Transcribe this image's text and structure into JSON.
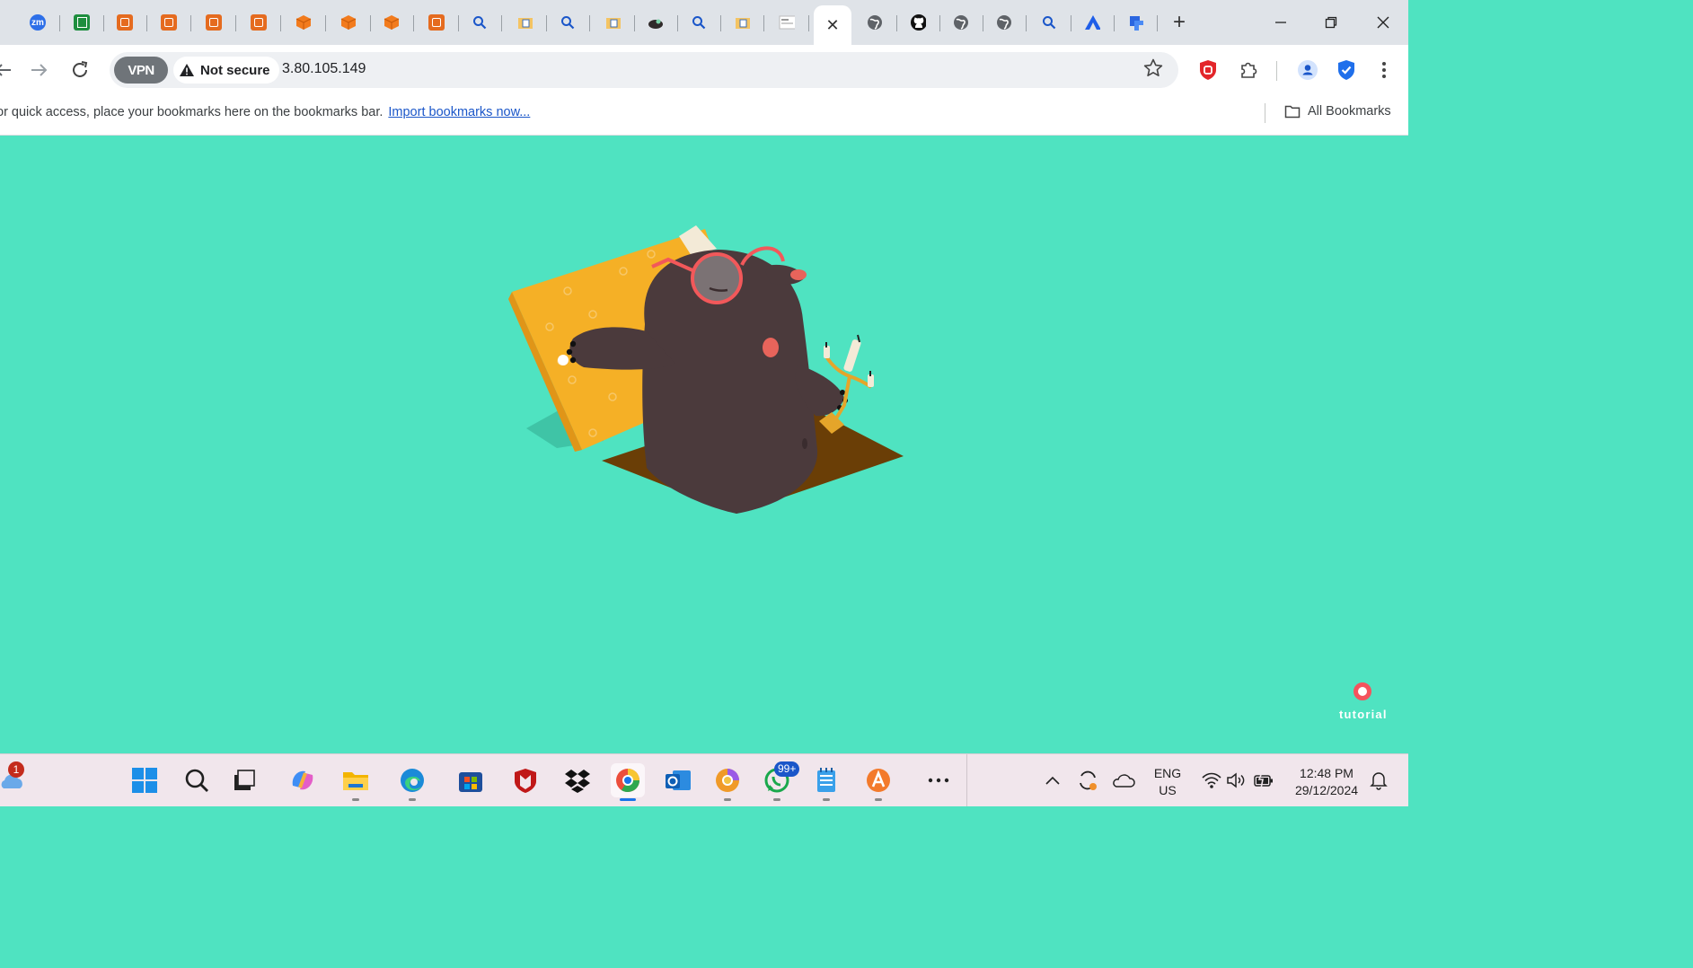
{
  "browser": {
    "tab_favicons": [
      "zoom-icon",
      "sheets-icon",
      "aws-icon",
      "aws-icon",
      "aws-icon",
      "aws-icon",
      "cube-icon",
      "cube-icon",
      "cube-icon",
      "aws-icon",
      "search-icon",
      "box-icon",
      "search-icon",
      "box-icon",
      "mole-icon",
      "search-icon",
      "box-icon",
      "thumbnail-icon",
      "globe-icon",
      "github-icon",
      "globe-icon",
      "globe-icon",
      "search-icon",
      "arrow-logo-icon",
      "jira-icon"
    ],
    "zoom_label": "zm",
    "new_tab_symbol": "+",
    "close_tab_symbol": "✕"
  },
  "toolbar": {
    "vpn_label": "VPN",
    "security_label": "Not secure",
    "url": "3.80.105.149"
  },
  "bookmarks_bar": {
    "message": "or quick access, place your bookmarks here on the bookmarks bar.",
    "import_link": "Import bookmarks now...",
    "all_bookmarks": "All Bookmarks"
  },
  "page": {
    "tutorial_label": "tutorial",
    "background_color": "#4fe3c1"
  },
  "taskbar": {
    "weather_badge": "1",
    "whatsapp_badge": "99+",
    "lang_top": "ENG",
    "lang_bottom": "US",
    "time": "12:48 PM",
    "date": "29/12/2024"
  }
}
